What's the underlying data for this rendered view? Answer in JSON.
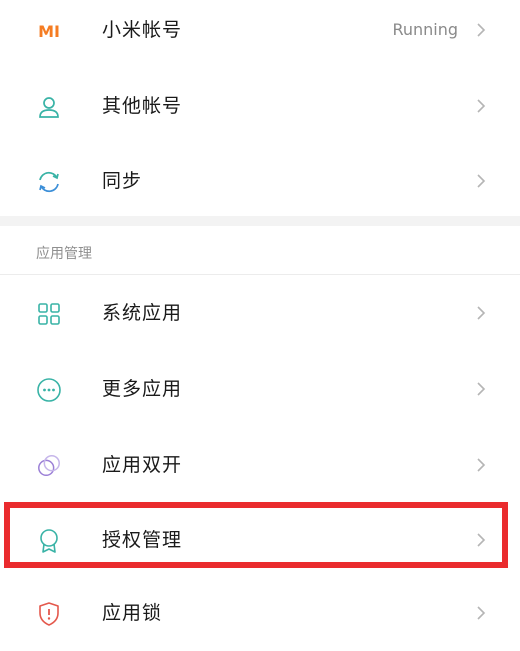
{
  "account": {
    "mi_account": {
      "label": "小米帐号",
      "value": "Running",
      "logo": "MI"
    },
    "other_accounts": {
      "label": "其他帐号"
    },
    "sync": {
      "label": "同步"
    }
  },
  "app_management": {
    "title": "应用管理",
    "items": [
      {
        "label": "系统应用",
        "icon": "grid-icon"
      },
      {
        "label": "更多应用",
        "icon": "more-icon"
      },
      {
        "label": "应用双开",
        "icon": "dual-app-icon"
      },
      {
        "label": "授权管理",
        "icon": "permission-icon"
      },
      {
        "label": "应用锁",
        "icon": "app-lock-icon"
      }
    ]
  },
  "colors": {
    "accent_orange": "#f57c22",
    "accent_teal": "#39b3a6",
    "highlight_red": "#ea2b2e"
  }
}
